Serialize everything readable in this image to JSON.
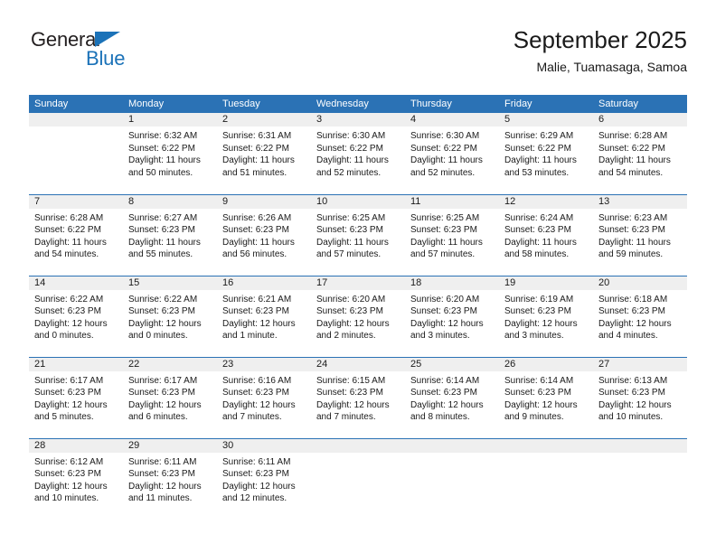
{
  "logo": {
    "word_top": "General",
    "word_bottom": "Blue",
    "accent_color": "#1b72b8",
    "text_color": "#231f20",
    "triangle_icon": "triangle-icon"
  },
  "header": {
    "title": "September 2025",
    "subtitle": "Malie, Tuamasaga, Samoa"
  },
  "theme": {
    "header_blue": "#2b72b5",
    "daynum_gray": "#efefef",
    "text": "#1a1a1a"
  },
  "weekdays": [
    "Sunday",
    "Monday",
    "Tuesday",
    "Wednesday",
    "Thursday",
    "Friday",
    "Saturday"
  ],
  "weeks": [
    [
      {
        "day": "",
        "sunrise": "",
        "sunset": "",
        "daylight1": "",
        "daylight2": ""
      },
      {
        "day": "1",
        "sunrise": "Sunrise: 6:32 AM",
        "sunset": "Sunset: 6:22 PM",
        "daylight1": "Daylight: 11 hours",
        "daylight2": "and 50 minutes."
      },
      {
        "day": "2",
        "sunrise": "Sunrise: 6:31 AM",
        "sunset": "Sunset: 6:22 PM",
        "daylight1": "Daylight: 11 hours",
        "daylight2": "and 51 minutes."
      },
      {
        "day": "3",
        "sunrise": "Sunrise: 6:30 AM",
        "sunset": "Sunset: 6:22 PM",
        "daylight1": "Daylight: 11 hours",
        "daylight2": "and 52 minutes."
      },
      {
        "day": "4",
        "sunrise": "Sunrise: 6:30 AM",
        "sunset": "Sunset: 6:22 PM",
        "daylight1": "Daylight: 11 hours",
        "daylight2": "and 52 minutes."
      },
      {
        "day": "5",
        "sunrise": "Sunrise: 6:29 AM",
        "sunset": "Sunset: 6:22 PM",
        "daylight1": "Daylight: 11 hours",
        "daylight2": "and 53 minutes."
      },
      {
        "day": "6",
        "sunrise": "Sunrise: 6:28 AM",
        "sunset": "Sunset: 6:22 PM",
        "daylight1": "Daylight: 11 hours",
        "daylight2": "and 54 minutes."
      }
    ],
    [
      {
        "day": "7",
        "sunrise": "Sunrise: 6:28 AM",
        "sunset": "Sunset: 6:22 PM",
        "daylight1": "Daylight: 11 hours",
        "daylight2": "and 54 minutes."
      },
      {
        "day": "8",
        "sunrise": "Sunrise: 6:27 AM",
        "sunset": "Sunset: 6:23 PM",
        "daylight1": "Daylight: 11 hours",
        "daylight2": "and 55 minutes."
      },
      {
        "day": "9",
        "sunrise": "Sunrise: 6:26 AM",
        "sunset": "Sunset: 6:23 PM",
        "daylight1": "Daylight: 11 hours",
        "daylight2": "and 56 minutes."
      },
      {
        "day": "10",
        "sunrise": "Sunrise: 6:25 AM",
        "sunset": "Sunset: 6:23 PM",
        "daylight1": "Daylight: 11 hours",
        "daylight2": "and 57 minutes."
      },
      {
        "day": "11",
        "sunrise": "Sunrise: 6:25 AM",
        "sunset": "Sunset: 6:23 PM",
        "daylight1": "Daylight: 11 hours",
        "daylight2": "and 57 minutes."
      },
      {
        "day": "12",
        "sunrise": "Sunrise: 6:24 AM",
        "sunset": "Sunset: 6:23 PM",
        "daylight1": "Daylight: 11 hours",
        "daylight2": "and 58 minutes."
      },
      {
        "day": "13",
        "sunrise": "Sunrise: 6:23 AM",
        "sunset": "Sunset: 6:23 PM",
        "daylight1": "Daylight: 11 hours",
        "daylight2": "and 59 minutes."
      }
    ],
    [
      {
        "day": "14",
        "sunrise": "Sunrise: 6:22 AM",
        "sunset": "Sunset: 6:23 PM",
        "daylight1": "Daylight: 12 hours",
        "daylight2": "and 0 minutes."
      },
      {
        "day": "15",
        "sunrise": "Sunrise: 6:22 AM",
        "sunset": "Sunset: 6:23 PM",
        "daylight1": "Daylight: 12 hours",
        "daylight2": "and 0 minutes."
      },
      {
        "day": "16",
        "sunrise": "Sunrise: 6:21 AM",
        "sunset": "Sunset: 6:23 PM",
        "daylight1": "Daylight: 12 hours",
        "daylight2": "and 1 minute."
      },
      {
        "day": "17",
        "sunrise": "Sunrise: 6:20 AM",
        "sunset": "Sunset: 6:23 PM",
        "daylight1": "Daylight: 12 hours",
        "daylight2": "and 2 minutes."
      },
      {
        "day": "18",
        "sunrise": "Sunrise: 6:20 AM",
        "sunset": "Sunset: 6:23 PM",
        "daylight1": "Daylight: 12 hours",
        "daylight2": "and 3 minutes."
      },
      {
        "day": "19",
        "sunrise": "Sunrise: 6:19 AM",
        "sunset": "Sunset: 6:23 PM",
        "daylight1": "Daylight: 12 hours",
        "daylight2": "and 3 minutes."
      },
      {
        "day": "20",
        "sunrise": "Sunrise: 6:18 AM",
        "sunset": "Sunset: 6:23 PM",
        "daylight1": "Daylight: 12 hours",
        "daylight2": "and 4 minutes."
      }
    ],
    [
      {
        "day": "21",
        "sunrise": "Sunrise: 6:17 AM",
        "sunset": "Sunset: 6:23 PM",
        "daylight1": "Daylight: 12 hours",
        "daylight2": "and 5 minutes."
      },
      {
        "day": "22",
        "sunrise": "Sunrise: 6:17 AM",
        "sunset": "Sunset: 6:23 PM",
        "daylight1": "Daylight: 12 hours",
        "daylight2": "and 6 minutes."
      },
      {
        "day": "23",
        "sunrise": "Sunrise: 6:16 AM",
        "sunset": "Sunset: 6:23 PM",
        "daylight1": "Daylight: 12 hours",
        "daylight2": "and 7 minutes."
      },
      {
        "day": "24",
        "sunrise": "Sunrise: 6:15 AM",
        "sunset": "Sunset: 6:23 PM",
        "daylight1": "Daylight: 12 hours",
        "daylight2": "and 7 minutes."
      },
      {
        "day": "25",
        "sunrise": "Sunrise: 6:14 AM",
        "sunset": "Sunset: 6:23 PM",
        "daylight1": "Daylight: 12 hours",
        "daylight2": "and 8 minutes."
      },
      {
        "day": "26",
        "sunrise": "Sunrise: 6:14 AM",
        "sunset": "Sunset: 6:23 PM",
        "daylight1": "Daylight: 12 hours",
        "daylight2": "and 9 minutes."
      },
      {
        "day": "27",
        "sunrise": "Sunrise: 6:13 AM",
        "sunset": "Sunset: 6:23 PM",
        "daylight1": "Daylight: 12 hours",
        "daylight2": "and 10 minutes."
      }
    ],
    [
      {
        "day": "28",
        "sunrise": "Sunrise: 6:12 AM",
        "sunset": "Sunset: 6:23 PM",
        "daylight1": "Daylight: 12 hours",
        "daylight2": "and 10 minutes."
      },
      {
        "day": "29",
        "sunrise": "Sunrise: 6:11 AM",
        "sunset": "Sunset: 6:23 PM",
        "daylight1": "Daylight: 12 hours",
        "daylight2": "and 11 minutes."
      },
      {
        "day": "30",
        "sunrise": "Sunrise: 6:11 AM",
        "sunset": "Sunset: 6:23 PM",
        "daylight1": "Daylight: 12 hours",
        "daylight2": "and 12 minutes."
      },
      {
        "day": "",
        "sunrise": "",
        "sunset": "",
        "daylight1": "",
        "daylight2": ""
      },
      {
        "day": "",
        "sunrise": "",
        "sunset": "",
        "daylight1": "",
        "daylight2": ""
      },
      {
        "day": "",
        "sunrise": "",
        "sunset": "",
        "daylight1": "",
        "daylight2": ""
      },
      {
        "day": "",
        "sunrise": "",
        "sunset": "",
        "daylight1": "",
        "daylight2": ""
      }
    ]
  ]
}
